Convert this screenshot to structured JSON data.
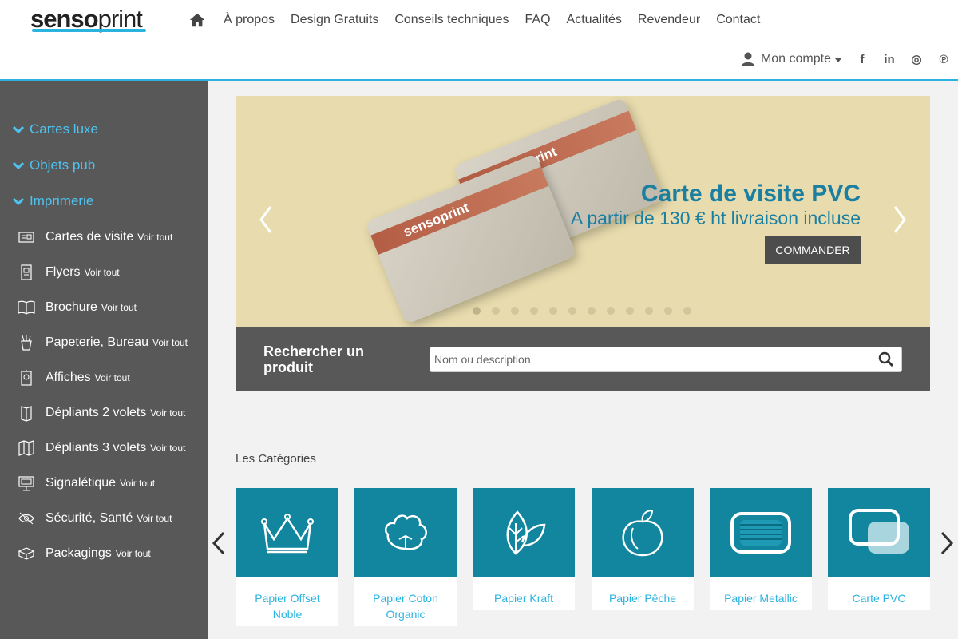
{
  "header": {
    "logo_bold": "senso",
    "logo_light": "print",
    "nav": [
      "À propos",
      "Design Gratuits",
      "Conseils techniques",
      "FAQ",
      "Actualités",
      "Revendeur",
      "Contact"
    ],
    "account_label": "Mon compte",
    "social": [
      {
        "icon": "facebook-icon",
        "glyph": "f"
      },
      {
        "icon": "linkedin-icon",
        "glyph": "in"
      },
      {
        "icon": "instagram-icon",
        "glyph": "◎"
      },
      {
        "icon": "pinterest-icon",
        "glyph": "℗"
      }
    ]
  },
  "sidebar": {
    "categories": [
      "Cartes luxe",
      "Objets pub",
      "Imprimerie"
    ],
    "see_all": "Voir tout",
    "items": [
      {
        "label": "Cartes de visite",
        "icon": "business-card-icon"
      },
      {
        "label": "Flyers",
        "icon": "flyer-icon"
      },
      {
        "label": "Brochure",
        "icon": "book-icon"
      },
      {
        "label": "Papeterie, Bureau",
        "icon": "stationery-icon"
      },
      {
        "label": "Affiches",
        "icon": "poster-icon"
      },
      {
        "label": "Dépliants 2 volets",
        "icon": "leaflet-2-icon"
      },
      {
        "label": "Dépliants 3 volets",
        "icon": "leaflet-3-icon"
      },
      {
        "label": "Signalétique",
        "icon": "signage-icon"
      },
      {
        "label": "Sécurité, Santé",
        "icon": "safety-icon"
      },
      {
        "label": "Packagings",
        "icon": "package-icon"
      }
    ]
  },
  "slider": {
    "card_brand": "sensoprint",
    "title": "Carte de visite PVC",
    "subtitle": "A partir de 130 € ht livraison incluse",
    "button": "COMMANDER",
    "dot_count": 12,
    "active_dot": 0,
    "bg_color": "#e8dcae"
  },
  "search": {
    "label": "Rechercher un produit",
    "placeholder": "Nom ou description"
  },
  "categories": {
    "title": "Les Catégories",
    "tiles": [
      {
        "name": "Papier Offset Noble",
        "icon": "crown-icon"
      },
      {
        "name": "Papier Coton Organic",
        "icon": "cotton-icon"
      },
      {
        "name": "Papier Kraft",
        "icon": "leaf-icon"
      },
      {
        "name": "Papier Pêche",
        "icon": "peach-icon"
      },
      {
        "name": "Papier Metallic",
        "icon": "metallic-card-icon"
      },
      {
        "name": "Carte PVC",
        "icon": "pvc-card-icon"
      }
    ],
    "tile_color": "#12859f"
  },
  "colors": {
    "accent": "#2bb3e0",
    "sidebar_bg": "#585858",
    "slide_text": "#1a7fa0"
  }
}
